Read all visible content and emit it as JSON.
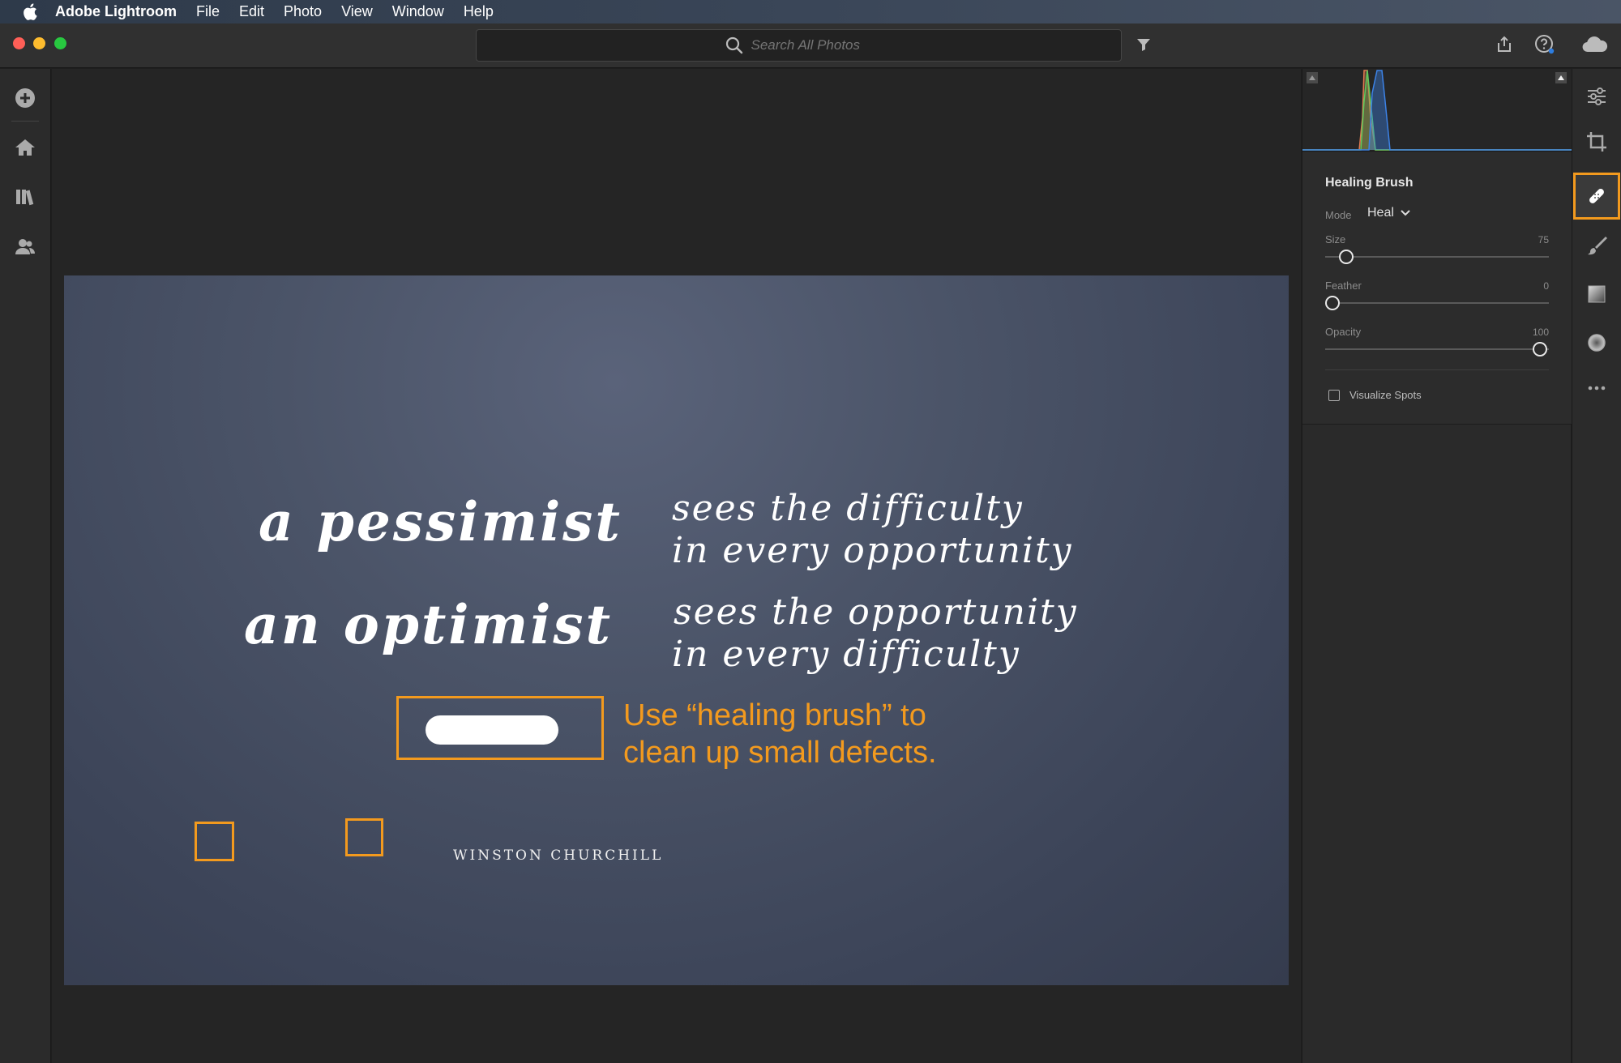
{
  "menubar": {
    "app_name": "Adobe Lightroom",
    "items": [
      "File",
      "Edit",
      "Photo",
      "View",
      "Window",
      "Help"
    ]
  },
  "search": {
    "placeholder": "Search All Photos"
  },
  "photo": {
    "line1_big": "a pessimist",
    "line1_small_a": "sees the difficulty",
    "line1_small_b": "in every opportunity",
    "line2_big": "an optimist",
    "line2_small_a": "sees the opportunity",
    "line2_small_b": "in every difficulty",
    "attribution": "WINSTON CHURCHILL",
    "annotation": "Use “healing brush” to\nclean up small defects."
  },
  "panel": {
    "title": "Healing Brush",
    "mode_label": "Mode",
    "mode_value": "Heal",
    "size_label": "Size",
    "size_value": "75",
    "feather_label": "Feather",
    "feather_value": "0",
    "opacity_label": "Opacity",
    "opacity_value": "100",
    "visualize_label": "Visualize Spots"
  },
  "colors": {
    "accent": "#f39a1e",
    "photo_bg": "#4b5468"
  },
  "icons": {
    "left_rail": [
      "add-icon",
      "home-icon",
      "library-icon",
      "people-icon"
    ],
    "tool_strip": [
      "edit-sliders-icon",
      "crop-icon",
      "healing-brush-icon",
      "brush-icon",
      "linear-gradient-icon",
      "radial-gradient-icon",
      "more-icon"
    ]
  }
}
